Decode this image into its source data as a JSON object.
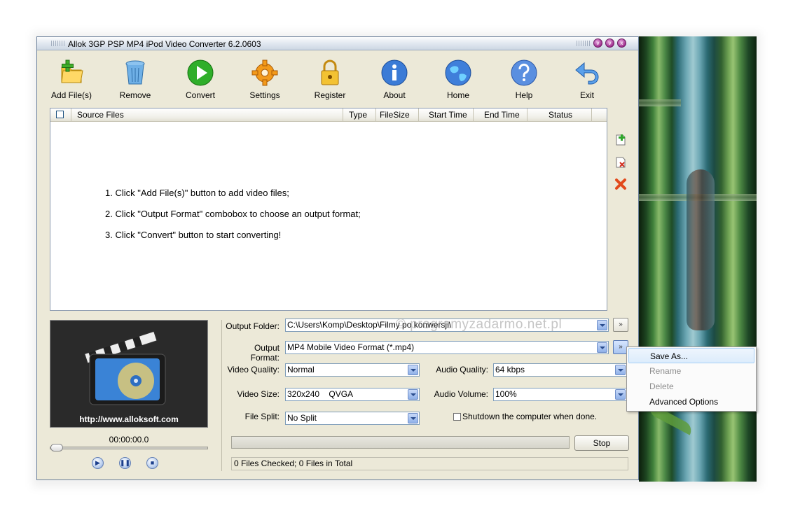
{
  "window": {
    "title": "Allok 3GP PSP MP4 iPod Video Converter 6.2.0603"
  },
  "toolbar": {
    "items": [
      {
        "label": "Add File(s)",
        "icon": "add-files-icon"
      },
      {
        "label": "Remove",
        "icon": "trash-icon"
      },
      {
        "label": "Convert",
        "icon": "play-icon"
      },
      {
        "label": "Settings",
        "icon": "gear-icon"
      },
      {
        "label": "Register",
        "icon": "lock-icon"
      },
      {
        "label": "About",
        "icon": "info-icon"
      },
      {
        "label": "Home",
        "icon": "globe-icon"
      },
      {
        "label": "Help",
        "icon": "help-icon"
      },
      {
        "label": "Exit",
        "icon": "exit-arrow-icon"
      }
    ]
  },
  "filelist": {
    "columns": [
      "Source Files",
      "Type",
      "FileSize",
      "Start Time",
      "End Time",
      "Status"
    ],
    "instructions": [
      "1. Click \"Add File(s)\" button to add video files;",
      "2. Click \"Output Format\" combobox to choose an output format;",
      "3. Click \"Convert\" button to start converting!"
    ]
  },
  "preview": {
    "url": "http://www.alloksoft.com",
    "time": "00:00:00.0"
  },
  "settings": {
    "output_folder_label": "Output Folder:",
    "output_folder_value": "C:\\Users\\Komp\\Desktop\\Filmy po konwersji\\",
    "output_format_label": "Output Format:",
    "output_format_value": "MP4 Mobile Video Format (*.mp4)",
    "video_quality_label": "Video Quality:",
    "video_quality_value": "Normal",
    "audio_quality_label": "Audio Quality:",
    "audio_quality_value": "64  kbps",
    "video_size_label": "Video Size:",
    "video_size_value": "320x240    QVGA",
    "audio_volume_label": "Audio Volume:",
    "audio_volume_value": "100%",
    "file_split_label": "File Split:",
    "file_split_value": "No Split",
    "shutdown_label": "Shutdown the computer when done.",
    "folder_button": "»",
    "format_button": "»"
  },
  "controls": {
    "stop_label": "Stop",
    "status_text": "0 Files Checked; 0 Files in Total"
  },
  "context_menu": {
    "items": [
      {
        "label": "Save As...",
        "state": "hover"
      },
      {
        "label": "Rename",
        "state": "disabled"
      },
      {
        "label": "Delete",
        "state": "disabled"
      },
      {
        "label": "Advanced Options",
        "state": "normal"
      }
    ]
  },
  "watermark": "© programyzadarmo.net.pl"
}
